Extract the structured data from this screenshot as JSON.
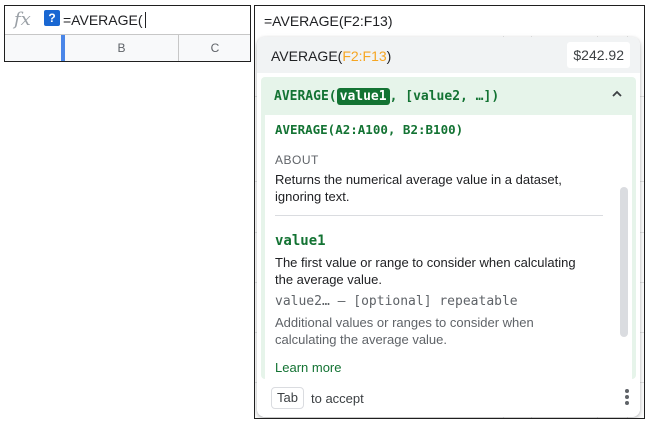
{
  "left_panel": {
    "fx_label": "fx",
    "help_icon": "?",
    "formula_text": "=AVERAGE(",
    "columns": [
      "B",
      "C"
    ]
  },
  "right_panel": {
    "formula_line": "=AVERAGE(F2:F13)",
    "preview": {
      "function": "AVERAGE(",
      "range": "F2:F13",
      "close": ")",
      "value": "$242.92"
    },
    "help": {
      "signature_prefix": "AVERAGE(",
      "signature_active_arg": "value1",
      "signature_rest": ", [value2, …])",
      "example": "AVERAGE(A2:A100, B2:B100)",
      "about_title": "ABOUT",
      "about_text": "Returns the numerical average value in a dataset, ignoring text.",
      "arg1_name": "value1",
      "arg1_text": "The first value or range to consider when calculating the average value.",
      "arg2_name": "value2… – [optional] repeatable",
      "arg2_text": "Additional values or ranges to consider when calculating the average value.",
      "learn_more": "Learn more"
    },
    "footer": {
      "tab_key": "Tab",
      "accept_text": "to accept"
    }
  },
  "colors": {
    "green_accent": "#137333",
    "green_card": "#e6f4ea",
    "range_orange": "#f6a623",
    "selection_blue": "#4a86e8"
  }
}
